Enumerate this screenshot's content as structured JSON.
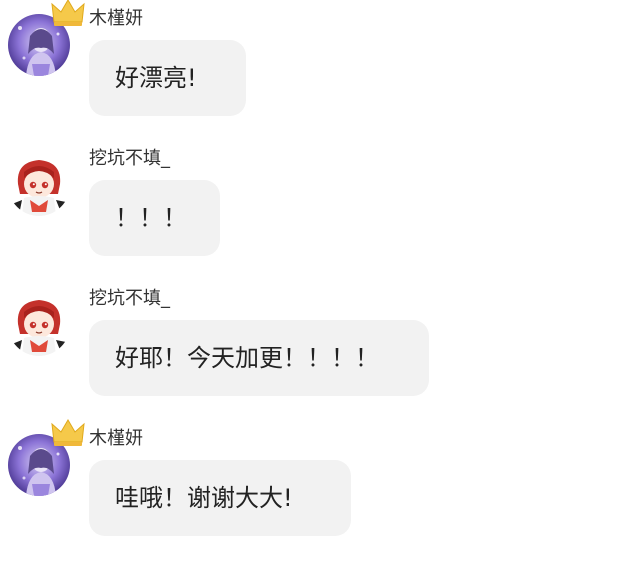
{
  "chat": {
    "messages": [
      {
        "sender": "木槿妍",
        "text": "好漂亮!",
        "avatar": "purple-anime-avatar",
        "crown": "crown-icon"
      },
      {
        "sender": "挖坑不填_",
        "text": "！！！",
        "avatar": "red-hair-anime-avatar"
      },
      {
        "sender": "挖坑不填_",
        "text": "好耶！今天加更！！！！",
        "avatar": "red-hair-anime-avatar"
      },
      {
        "sender": "木槿妍",
        "text": "哇哦！谢谢大大!",
        "avatar": "purple-anime-avatar",
        "crown": "crown-icon"
      }
    ]
  },
  "colors": {
    "bubble": "#f2f2f2",
    "crown": "#f5c94a",
    "avatar_purple": "#7b63c9",
    "avatar_red": "#c4312b"
  }
}
